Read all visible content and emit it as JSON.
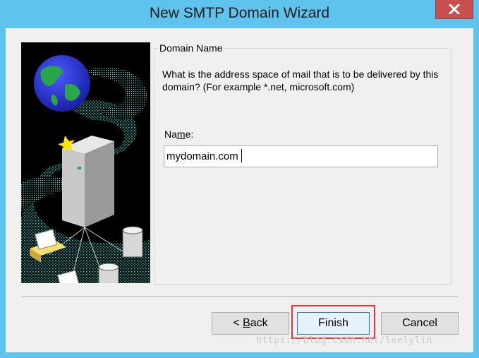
{
  "window": {
    "title": "New SMTP Domain Wizard",
    "close_label": "Close"
  },
  "illustration": {
    "icon": "globe-server-mail-illustration"
  },
  "group": {
    "legend": "Domain Name",
    "description": "What is the address space of mail that is to be delivered by this domain? (For example *.net, microsoft.com)"
  },
  "field": {
    "label_prefix": "Na",
    "label_accel": "m",
    "label_suffix": "e:",
    "value": "mydomain.com"
  },
  "buttons": {
    "back_prefix": "< ",
    "back_accel": "B",
    "back_suffix": "ack",
    "finish": "Finish",
    "cancel": "Cancel"
  },
  "watermark": "https://blog.csdn.net/leelylin",
  "colors": {
    "frame": "#5ec4ee",
    "close": "#c7504f",
    "highlight": "#e0393b"
  }
}
